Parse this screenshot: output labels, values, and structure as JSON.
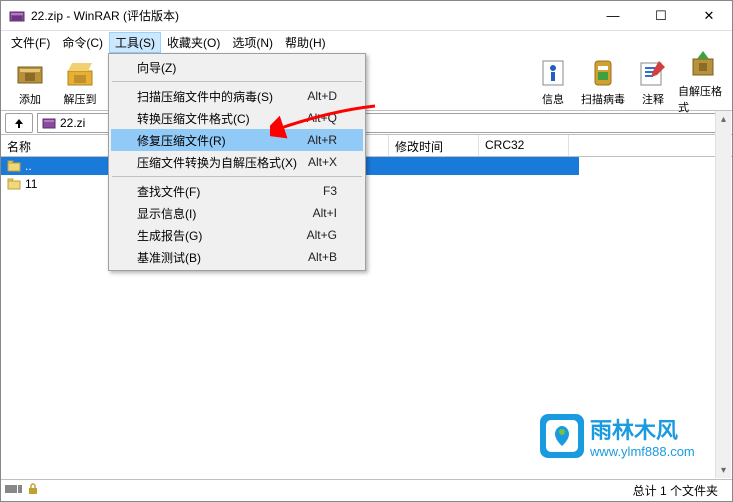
{
  "window": {
    "title": "22.zip - WinRAR (评估版本)"
  },
  "menubar": {
    "file": "文件(F)",
    "commands": "命令(C)",
    "tools": "工具(S)",
    "favorites": "收藏夹(O)",
    "options": "选项(N)",
    "help": "帮助(H)"
  },
  "dropdown": {
    "wizard": "向导(Z)",
    "scan_virus": "扫描压缩文件中的病毒(S)",
    "scan_virus_key": "Alt+D",
    "convert": "转换压缩文件格式(C)",
    "convert_key": "Alt+Q",
    "repair": "修复压缩文件(R)",
    "repair_key": "Alt+R",
    "convert_sfx": "压缩文件转换为自解压格式(X)",
    "convert_sfx_key": "Alt+X",
    "find": "查找文件(F)",
    "find_key": "F3",
    "show_info": "显示信息(I)",
    "show_info_key": "Alt+I",
    "report": "生成报告(G)",
    "report_key": "Alt+G",
    "benchmark": "基准测试(B)",
    "benchmark_key": "Alt+B"
  },
  "toolbar": {
    "add": "添加",
    "extract": "解压到",
    "info": "信息",
    "scan": "扫描病毒",
    "comment": "注释",
    "sfx": "自解压格式"
  },
  "path": {
    "filename": "22.zi"
  },
  "columns": {
    "name": "名称",
    "modified": "修改时间",
    "crc": "CRC32"
  },
  "files": {
    "parent": "..",
    "item1": "11"
  },
  "status": {
    "total": "总计 1 个文件夹"
  },
  "watermark": {
    "text": "雨林木风",
    "url": "www.ylmf888.com"
  }
}
